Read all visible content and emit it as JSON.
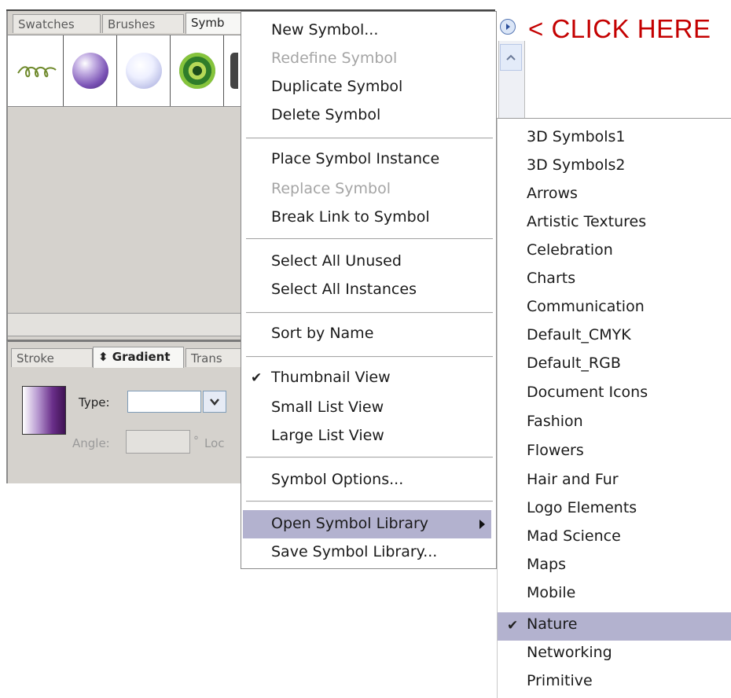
{
  "symbols_panel": {
    "tabs": [
      "Swatches",
      "Brushes",
      "Symb"
    ]
  },
  "gradient_panel": {
    "tabs": [
      "Stroke",
      "⬍ Gradient",
      "Trans"
    ],
    "type_label": "Type:",
    "type_value": "",
    "angle_label": "Angle:",
    "degree_symbol": "°",
    "location_label": "Loc"
  },
  "flyout_menu": {
    "items": [
      {
        "label": "New Symbol...",
        "enabled": true
      },
      {
        "label": "Redefine Symbol",
        "enabled": false
      },
      {
        "label": "Duplicate Symbol",
        "enabled": true
      },
      {
        "label": "Delete Symbol",
        "enabled": true
      },
      {
        "label": "Place Symbol Instance",
        "enabled": true
      },
      {
        "label": "Replace Symbol",
        "enabled": false
      },
      {
        "label": "Break Link to Symbol",
        "enabled": true
      },
      {
        "label": "Select All Unused",
        "enabled": true
      },
      {
        "label": "Select All Instances",
        "enabled": true
      },
      {
        "label": "Sort by Name",
        "enabled": true
      },
      {
        "label": "Thumbnail View",
        "enabled": true,
        "checked": true
      },
      {
        "label": "Small List View",
        "enabled": true
      },
      {
        "label": "Large List View",
        "enabled": true
      },
      {
        "label": "Symbol Options...",
        "enabled": true
      },
      {
        "label": "Open Symbol Library",
        "enabled": true,
        "submenu": true,
        "highlighted": true
      },
      {
        "label": "Save Symbol Library...",
        "enabled": true
      }
    ]
  },
  "annotation": "< CLICK HERE",
  "library_submenu": {
    "items": [
      "3D Symbols1",
      "3D Symbols2",
      "Arrows",
      "Artistic Textures",
      "Celebration",
      "Charts",
      "Communication",
      "Default_CMYK",
      "Default_RGB",
      "Document Icons",
      "Fashion",
      "Flowers",
      "Hair and Fur",
      "Logo Elements",
      "Mad Science",
      "Maps",
      "Mobile",
      "Nature",
      "Networking",
      "Primitive"
    ],
    "selected": "Nature"
  },
  "check_glyph": "✔",
  "colors": {
    "highlight": "#b3b2cf",
    "annotation": "#c40000",
    "panel_bg": "#d5d2cd"
  }
}
